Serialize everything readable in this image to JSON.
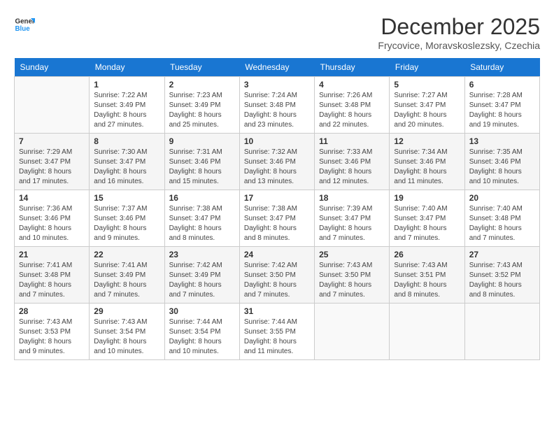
{
  "header": {
    "logo_line1": "General",
    "logo_line2": "Blue",
    "month": "December 2025",
    "location": "Frycovice, Moravskoslezsky, Czechia"
  },
  "days_of_week": [
    "Sunday",
    "Monday",
    "Tuesday",
    "Wednesday",
    "Thursday",
    "Friday",
    "Saturday"
  ],
  "weeks": [
    [
      {
        "day": "",
        "empty": true
      },
      {
        "day": "1",
        "sunrise": "7:22 AM",
        "sunset": "3:49 PM",
        "daylight": "8 hours and 27 minutes."
      },
      {
        "day": "2",
        "sunrise": "7:23 AM",
        "sunset": "3:49 PM",
        "daylight": "8 hours and 25 minutes."
      },
      {
        "day": "3",
        "sunrise": "7:24 AM",
        "sunset": "3:48 PM",
        "daylight": "8 hours and 23 minutes."
      },
      {
        "day": "4",
        "sunrise": "7:26 AM",
        "sunset": "3:48 PM",
        "daylight": "8 hours and 22 minutes."
      },
      {
        "day": "5",
        "sunrise": "7:27 AM",
        "sunset": "3:47 PM",
        "daylight": "8 hours and 20 minutes."
      },
      {
        "day": "6",
        "sunrise": "7:28 AM",
        "sunset": "3:47 PM",
        "daylight": "8 hours and 19 minutes."
      }
    ],
    [
      {
        "day": "7",
        "sunrise": "7:29 AM",
        "sunset": "3:47 PM",
        "daylight": "8 hours and 17 minutes."
      },
      {
        "day": "8",
        "sunrise": "7:30 AM",
        "sunset": "3:47 PM",
        "daylight": "8 hours and 16 minutes."
      },
      {
        "day": "9",
        "sunrise": "7:31 AM",
        "sunset": "3:46 PM",
        "daylight": "8 hours and 15 minutes."
      },
      {
        "day": "10",
        "sunrise": "7:32 AM",
        "sunset": "3:46 PM",
        "daylight": "8 hours and 13 minutes."
      },
      {
        "day": "11",
        "sunrise": "7:33 AM",
        "sunset": "3:46 PM",
        "daylight": "8 hours and 12 minutes."
      },
      {
        "day": "12",
        "sunrise": "7:34 AM",
        "sunset": "3:46 PM",
        "daylight": "8 hours and 11 minutes."
      },
      {
        "day": "13",
        "sunrise": "7:35 AM",
        "sunset": "3:46 PM",
        "daylight": "8 hours and 10 minutes."
      }
    ],
    [
      {
        "day": "14",
        "sunrise": "7:36 AM",
        "sunset": "3:46 PM",
        "daylight": "8 hours and 10 minutes."
      },
      {
        "day": "15",
        "sunrise": "7:37 AM",
        "sunset": "3:46 PM",
        "daylight": "8 hours and 9 minutes."
      },
      {
        "day": "16",
        "sunrise": "7:38 AM",
        "sunset": "3:47 PM",
        "daylight": "8 hours and 8 minutes."
      },
      {
        "day": "17",
        "sunrise": "7:38 AM",
        "sunset": "3:47 PM",
        "daylight": "8 hours and 8 minutes."
      },
      {
        "day": "18",
        "sunrise": "7:39 AM",
        "sunset": "3:47 PM",
        "daylight": "8 hours and 7 minutes."
      },
      {
        "day": "19",
        "sunrise": "7:40 AM",
        "sunset": "3:47 PM",
        "daylight": "8 hours and 7 minutes."
      },
      {
        "day": "20",
        "sunrise": "7:40 AM",
        "sunset": "3:48 PM",
        "daylight": "8 hours and 7 minutes."
      }
    ],
    [
      {
        "day": "21",
        "sunrise": "7:41 AM",
        "sunset": "3:48 PM",
        "daylight": "8 hours and 7 minutes."
      },
      {
        "day": "22",
        "sunrise": "7:41 AM",
        "sunset": "3:49 PM",
        "daylight": "8 hours and 7 minutes."
      },
      {
        "day": "23",
        "sunrise": "7:42 AM",
        "sunset": "3:49 PM",
        "daylight": "8 hours and 7 minutes."
      },
      {
        "day": "24",
        "sunrise": "7:42 AM",
        "sunset": "3:50 PM",
        "daylight": "8 hours and 7 minutes."
      },
      {
        "day": "25",
        "sunrise": "7:43 AM",
        "sunset": "3:50 PM",
        "daylight": "8 hours and 7 minutes."
      },
      {
        "day": "26",
        "sunrise": "7:43 AM",
        "sunset": "3:51 PM",
        "daylight": "8 hours and 8 minutes."
      },
      {
        "day": "27",
        "sunrise": "7:43 AM",
        "sunset": "3:52 PM",
        "daylight": "8 hours and 8 minutes."
      }
    ],
    [
      {
        "day": "28",
        "sunrise": "7:43 AM",
        "sunset": "3:53 PM",
        "daylight": "8 hours and 9 minutes."
      },
      {
        "day": "29",
        "sunrise": "7:43 AM",
        "sunset": "3:54 PM",
        "daylight": "8 hours and 10 minutes."
      },
      {
        "day": "30",
        "sunrise": "7:44 AM",
        "sunset": "3:54 PM",
        "daylight": "8 hours and 10 minutes."
      },
      {
        "day": "31",
        "sunrise": "7:44 AM",
        "sunset": "3:55 PM",
        "daylight": "8 hours and 11 minutes."
      },
      {
        "day": "",
        "empty": true
      },
      {
        "day": "",
        "empty": true
      },
      {
        "day": "",
        "empty": true
      }
    ]
  ]
}
